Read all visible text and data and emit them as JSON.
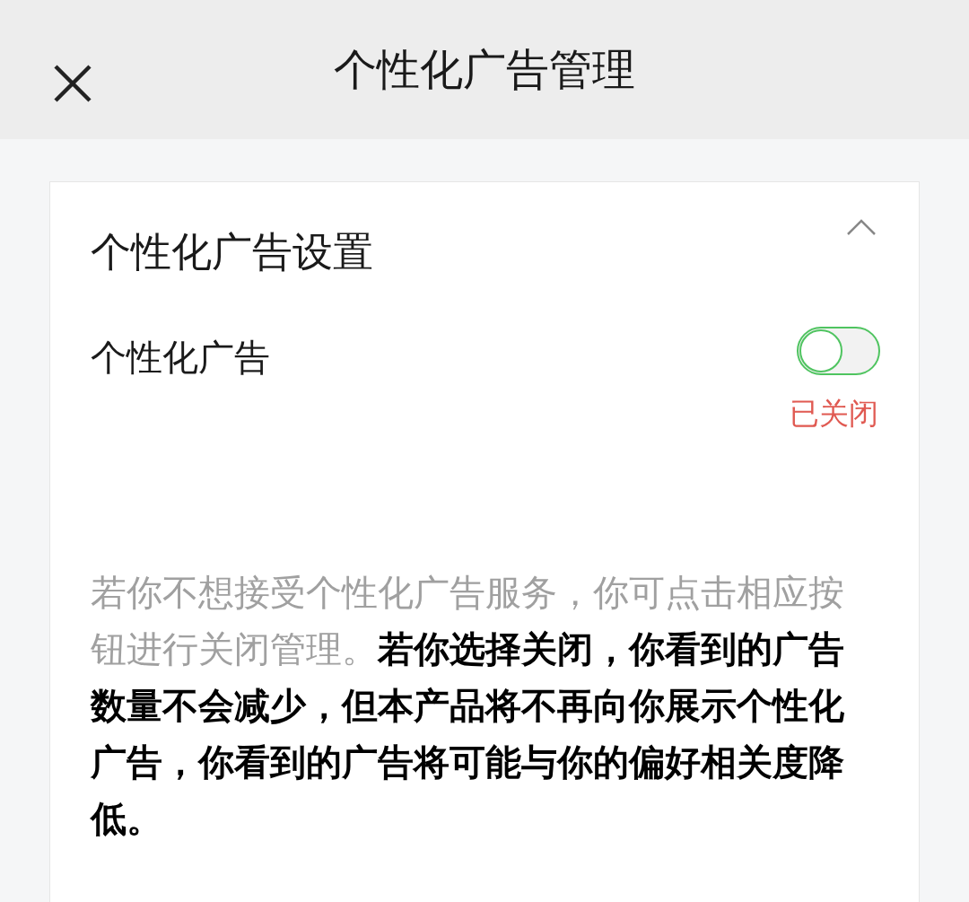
{
  "header": {
    "title": "个性化广告管理"
  },
  "section": {
    "title": "个性化广告设置",
    "expanded": true,
    "setting": {
      "label": "个性化广告",
      "on": false,
      "status": "已关闭"
    },
    "description": "若你不想接受个性化广告服务，你可点击相应按钮进行关闭管理。**若你选择关闭，你看到的广告数量不会减少，但本产品将不再向你展示个性化广告，你看到的广告将可能与你的偏好相关度降低。**"
  }
}
